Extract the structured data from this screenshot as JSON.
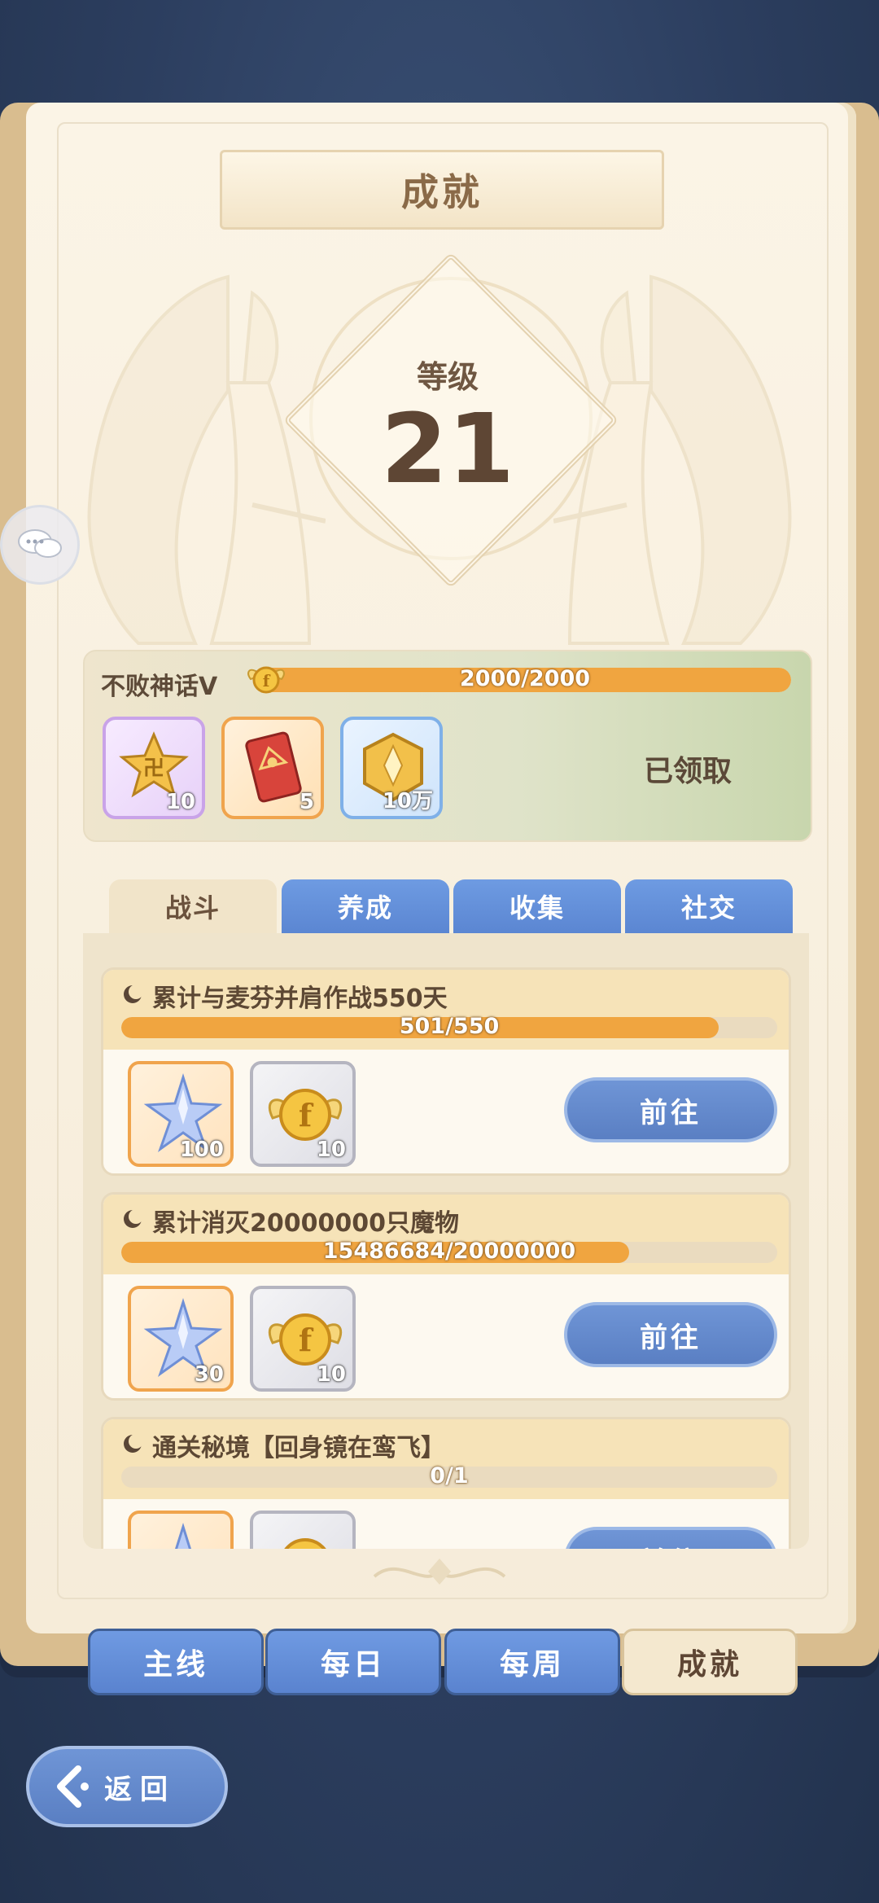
{
  "title": "成就",
  "level": {
    "label": "等级",
    "value": "21"
  },
  "current_achievement": {
    "name": "不败神话V",
    "progress_text": "2000/2000",
    "progress": 1.0,
    "status": "已领取",
    "rewards": [
      {
        "icon": "star-badge-icon",
        "qty": "10",
        "rarity": "purple"
      },
      {
        "icon": "eye-card-icon",
        "qty": "5",
        "rarity": "orange"
      },
      {
        "icon": "gold-coin-icon",
        "qty": "10万",
        "rarity": "blue"
      }
    ]
  },
  "tabs": [
    {
      "label": "战斗",
      "active": true
    },
    {
      "label": "养成",
      "active": false
    },
    {
      "label": "收集",
      "active": false
    },
    {
      "label": "社交",
      "active": false
    }
  ],
  "quests": [
    {
      "title": "累计与麦芬并肩作战550天",
      "progress_text": "501/550",
      "progress": 0.911,
      "button": "前往",
      "rewards": [
        {
          "icon": "blue-star-crystal-icon",
          "qty": "100",
          "rarity": "orange"
        },
        {
          "icon": "winged-coin-icon",
          "qty": "10",
          "rarity": "gray"
        }
      ]
    },
    {
      "title": "累计消灭20000000只魔物",
      "progress_text": "15486684/20000000",
      "progress": 0.774,
      "button": "前往",
      "rewards": [
        {
          "icon": "blue-star-crystal-icon",
          "qty": "30",
          "rarity": "orange"
        },
        {
          "icon": "winged-coin-icon",
          "qty": "10",
          "rarity": "gray"
        }
      ]
    },
    {
      "title": "通关秘境【回身镜在鸾飞】",
      "progress_text": "0/1",
      "progress": 0.0,
      "button": "前往",
      "rewards": [
        {
          "icon": "blue-star-crystal-icon",
          "qty": "",
          "rarity": "orange"
        },
        {
          "icon": "winged-coin-icon",
          "qty": "",
          "rarity": "gray"
        }
      ]
    }
  ],
  "bottom_tabs": [
    {
      "label": "主线",
      "active": false
    },
    {
      "label": "每日",
      "active": false
    },
    {
      "label": "每周",
      "active": false
    },
    {
      "label": "成就",
      "active": true
    }
  ],
  "back_button": {
    "label": "返回"
  },
  "colors": {
    "progress": "#f0a540",
    "button": "#5a7fc3",
    "page": "#fbf4e6"
  }
}
